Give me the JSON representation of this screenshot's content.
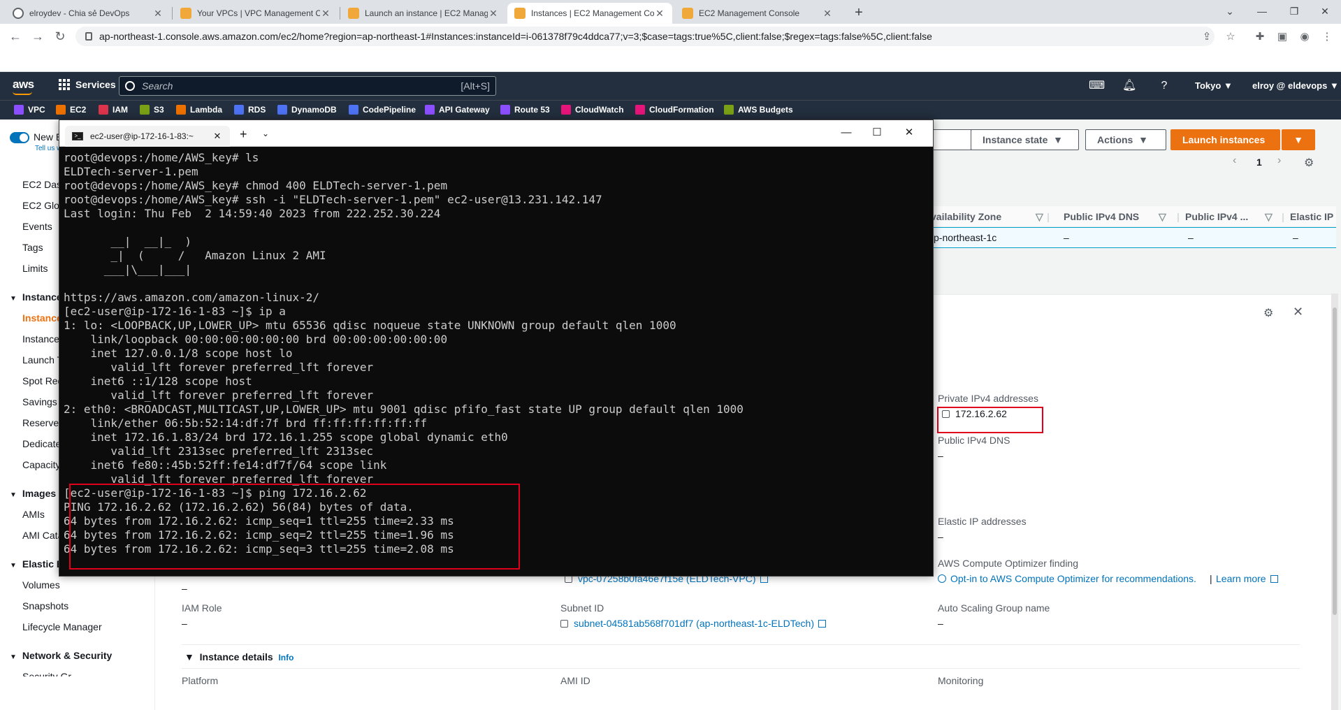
{
  "browser": {
    "tabs": [
      {
        "title": "elroydev - Chia sẻ DevOps",
        "icon": "github-icon",
        "active": false
      },
      {
        "title": "Your VPCs | VPC Management Co",
        "icon": "aws-icon",
        "active": false
      },
      {
        "title": "Launch an instance | EC2 Manag",
        "icon": "aws-icon",
        "active": false
      },
      {
        "title": "Instances | EC2 Management Cor",
        "icon": "aws-icon",
        "active": true
      },
      {
        "title": "EC2 Management Console",
        "icon": "aws-icon",
        "active": false
      }
    ],
    "url": "ap-northeast-1.console.aws.amazon.com/ec2/home?region=ap-northeast-1#Instances:instanceId=i-061378f79c4ddca77;v=3;$case=tags:true%5C,client:false;$regex=tags:false%5C,client:false"
  },
  "aws": {
    "logo": "aws",
    "services": "Services",
    "search_placeholder": "Search",
    "search_shortcut": "[Alt+S]",
    "region": "Tokyo",
    "account": "elroy @ eldevops",
    "favorites": [
      {
        "label": "VPC",
        "color": "#8c4fff"
      },
      {
        "label": "EC2",
        "color": "#ed7100"
      },
      {
        "label": "IAM",
        "color": "#dd344c"
      },
      {
        "label": "S3",
        "color": "#7aa116"
      },
      {
        "label": "Lambda",
        "color": "#ed7100"
      },
      {
        "label": "RDS",
        "color": "#4d72f3"
      },
      {
        "label": "DynamoDB",
        "color": "#4d72f3"
      },
      {
        "label": "CodePipeline",
        "color": "#4d72f3"
      },
      {
        "label": "API Gateway",
        "color": "#8c4fff"
      },
      {
        "label": "Route 53",
        "color": "#8c4fff"
      },
      {
        "label": "CloudWatch",
        "color": "#e7157b"
      },
      {
        "label": "CloudFormation",
        "color": "#e7157b"
      },
      {
        "label": "AWS Budgets",
        "color": "#7aa116"
      }
    ],
    "sidebar": {
      "new_ec2": "New EC2",
      "tell_us": "Tell us wha",
      "top_items": [
        "EC2 Dashb",
        "EC2 Global",
        "Events",
        "Tags",
        "Limits"
      ],
      "instances_header": "Instances",
      "instances_items": [
        "Instances",
        "Instance Ty",
        "Launch Ter",
        "Spot Reque",
        "Savings Pla",
        "Reserved In",
        "Dedicated",
        "Capacity Re"
      ],
      "images_header": "Images",
      "images_items": [
        "AMIs",
        "AMI Catalo"
      ],
      "ebs_header": "Elastic Blo",
      "ebs_items": [
        "Volumes",
        "Snapshots",
        "Lifecycle Manager"
      ],
      "network_header": "Network & Security",
      "network_items": [
        "Security Gr"
      ]
    },
    "toolbar": {
      "connect": "nect",
      "instance_state": "Instance state",
      "actions": "Actions",
      "launch": "Launch instances",
      "page": "1"
    },
    "table": {
      "columns": [
        "vailability Zone",
        "Public IPv4 DNS",
        "Public IPv4 ...",
        "Elastic IP"
      ],
      "row": [
        "p-northeast-1c",
        "–",
        "–",
        "–"
      ]
    },
    "details": {
      "private_ipv4_label": "Private IPv4 addresses",
      "private_ipv4_value": "172.16.2.62",
      "public_dns_label": "Public IPv4 DNS",
      "public_dns_value": "–",
      "elastic_ip_label": "Elastic IP addresses",
      "elastic_ip_value": "–",
      "optimizer_label": "AWS Compute Optimizer finding",
      "optimizer_value": "Opt-in to AWS Compute Optimizer for recommendations.",
      "optimizer_sep": "|",
      "learn_more": "Learn more",
      "col1_dash": "–",
      "vpc_value": "vpc-07258b0fa46e7f15e (ELDTech-VPC)",
      "iam_label": "IAM Role",
      "iam_value": "–",
      "subnet_label": "Subnet ID",
      "subnet_value": "subnet-04581ab568f701df7 (ap-northeast-1c-ELDTech)",
      "asg_label": "Auto Scaling Group name",
      "asg_value": "–",
      "instance_details": "Instance details",
      "info": "Info",
      "platform_label": "Platform",
      "ami_label": "AMI ID",
      "monitoring_label": "Monitoring"
    }
  },
  "terminal": {
    "tab_title": "ec2-user@ip-172-16-1-83:~",
    "lines": [
      "root@devops:/home/AWS_key# ls",
      "ELDTech-server-1.pem",
      "root@devops:/home/AWS_key# chmod 400 ELDTech-server-1.pem",
      "root@devops:/home/AWS_key# ssh -i \"ELDTech-server-1.pem\" ec2-user@13.231.142.147",
      "Last login: Thu Feb  2 14:59:40 2023 from 222.252.30.224",
      "",
      "       __|  __|_  )",
      "       _|  (     /   Amazon Linux 2 AMI",
      "      ___|\\___|___|",
      "",
      "https://aws.amazon.com/amazon-linux-2/",
      "[ec2-user@ip-172-16-1-83 ~]$ ip a",
      "1: lo: <LOOPBACK,UP,LOWER_UP> mtu 65536 qdisc noqueue state UNKNOWN group default qlen 1000",
      "    link/loopback 00:00:00:00:00:00 brd 00:00:00:00:00:00",
      "    inet 127.0.0.1/8 scope host lo",
      "       valid_lft forever preferred_lft forever",
      "    inet6 ::1/128 scope host",
      "       valid_lft forever preferred_lft forever",
      "2: eth0: <BROADCAST,MULTICAST,UP,LOWER_UP> mtu 9001 qdisc pfifo_fast state UP group default qlen 1000",
      "    link/ether 06:5b:52:14:df:7f brd ff:ff:ff:ff:ff:ff",
      "    inet 172.16.1.83/24 brd 172.16.1.255 scope global dynamic eth0",
      "       valid_lft 2313sec preferred_lft 2313sec",
      "    inet6 fe80::45b:52ff:fe14:df7f/64 scope link",
      "       valid_lft forever preferred_lft forever",
      "[ec2-user@ip-172-16-1-83 ~]$ ping 172.16.2.62",
      "PING 172.16.2.62 (172.16.2.62) 56(84) bytes of data.",
      "64 bytes from 172.16.2.62: icmp_seq=1 ttl=255 time=2.33 ms",
      "64 bytes from 172.16.2.62: icmp_seq=2 ttl=255 time=1.96 ms",
      "64 bytes from 172.16.2.62: icmp_seq=3 ttl=255 time=2.08 ms"
    ]
  },
  "colors": {
    "aws_orange": "#ec7211",
    "aws_nav": "#232f3e",
    "highlight_red": "#e0001b",
    "link_blue": "#0073bb"
  }
}
